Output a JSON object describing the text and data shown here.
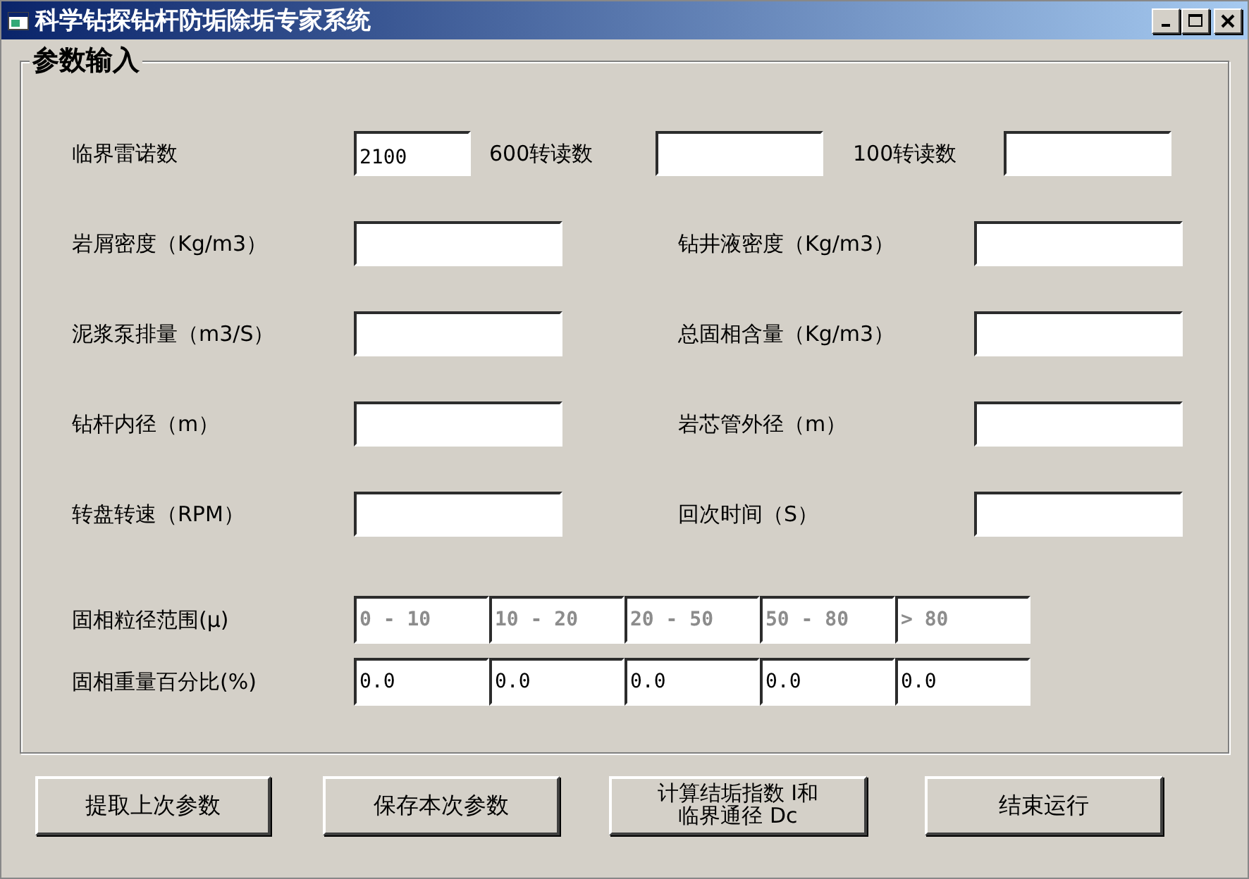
{
  "window": {
    "title": "科学钻探钻杆防垢除垢专家系统"
  },
  "group": {
    "title": "参数输入"
  },
  "top_row": [
    {
      "label": "临界雷诺数",
      "value": "2100"
    },
    {
      "label": "600转读数"
    },
    {
      "label": "100转读数"
    }
  ],
  "fields": [
    {
      "label": "岩屑密度（Kg/m3）"
    },
    {
      "label": "钻井液密度（Kg/m3）"
    },
    {
      "label": "泥浆泵排量（m3/S）"
    },
    {
      "label": "总固相含量（Kg/m3）"
    },
    {
      "label": "钻杆内径（m）"
    },
    {
      "label": "岩芯管外径（m）"
    },
    {
      "label": "转盘转速（RPM）"
    },
    {
      "label": "回次时间（S）"
    }
  ],
  "grid_rows": [
    {
      "label": "固相粒径范围(μ)",
      "disabled": true,
      "cells": [
        "0 - 10",
        "10 - 20",
        "20 - 50",
        "50 - 80",
        "> 80"
      ]
    },
    {
      "label": "固相重量百分比(%)",
      "disabled": false,
      "cells": [
        "0.0",
        "0.0",
        "0.0",
        "0.0",
        "0.0"
      ]
    }
  ],
  "buttons": [
    {
      "lines": [
        "提取上次参数"
      ]
    },
    {
      "lines": [
        "保存本次参数"
      ]
    },
    {
      "lines": [
        "计算结垢指数 I和",
        "临界通径  Dc"
      ]
    },
    {
      "lines": [
        "结束运行"
      ]
    }
  ]
}
